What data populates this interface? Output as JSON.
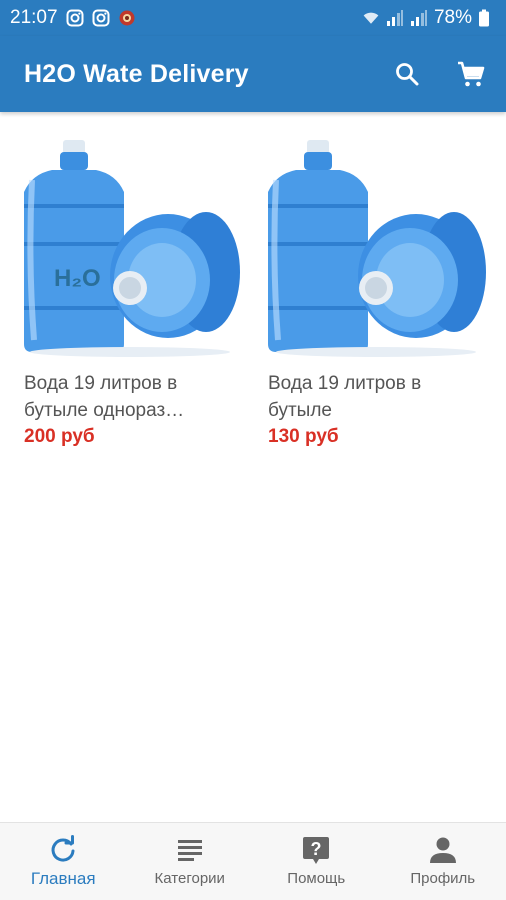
{
  "status_bar": {
    "time": "21:07",
    "battery": "78%",
    "left_icons": [
      "instagram-icon",
      "instagram-icon",
      "notification-icon"
    ],
    "right_icons": [
      "wifi-icon",
      "signal-icon",
      "signal-icon",
      "battery-icon"
    ]
  },
  "app_bar": {
    "title": "H2O Wate Delivery",
    "actions": [
      "search-icon",
      "cart-icon"
    ]
  },
  "products": [
    {
      "name": "Вода 19 литров в бутыле однораз…",
      "price": "200 руб",
      "image_label": "H₂O"
    },
    {
      "name": "Вода 19 литров в бутыле",
      "price": "130 руб"
    }
  ],
  "bottom_nav": {
    "items": [
      {
        "label": "Главная",
        "icon": "refresh-icon",
        "active": true
      },
      {
        "label": "Категории",
        "icon": "list-icon",
        "active": false
      },
      {
        "label": "Помощь",
        "icon": "help-icon",
        "active": false
      },
      {
        "label": "Профиль",
        "icon": "person-icon",
        "active": false
      }
    ]
  },
  "colors": {
    "primary": "#2b7cbf",
    "price": "#d93025",
    "active_nav": "#2b7cbf"
  }
}
